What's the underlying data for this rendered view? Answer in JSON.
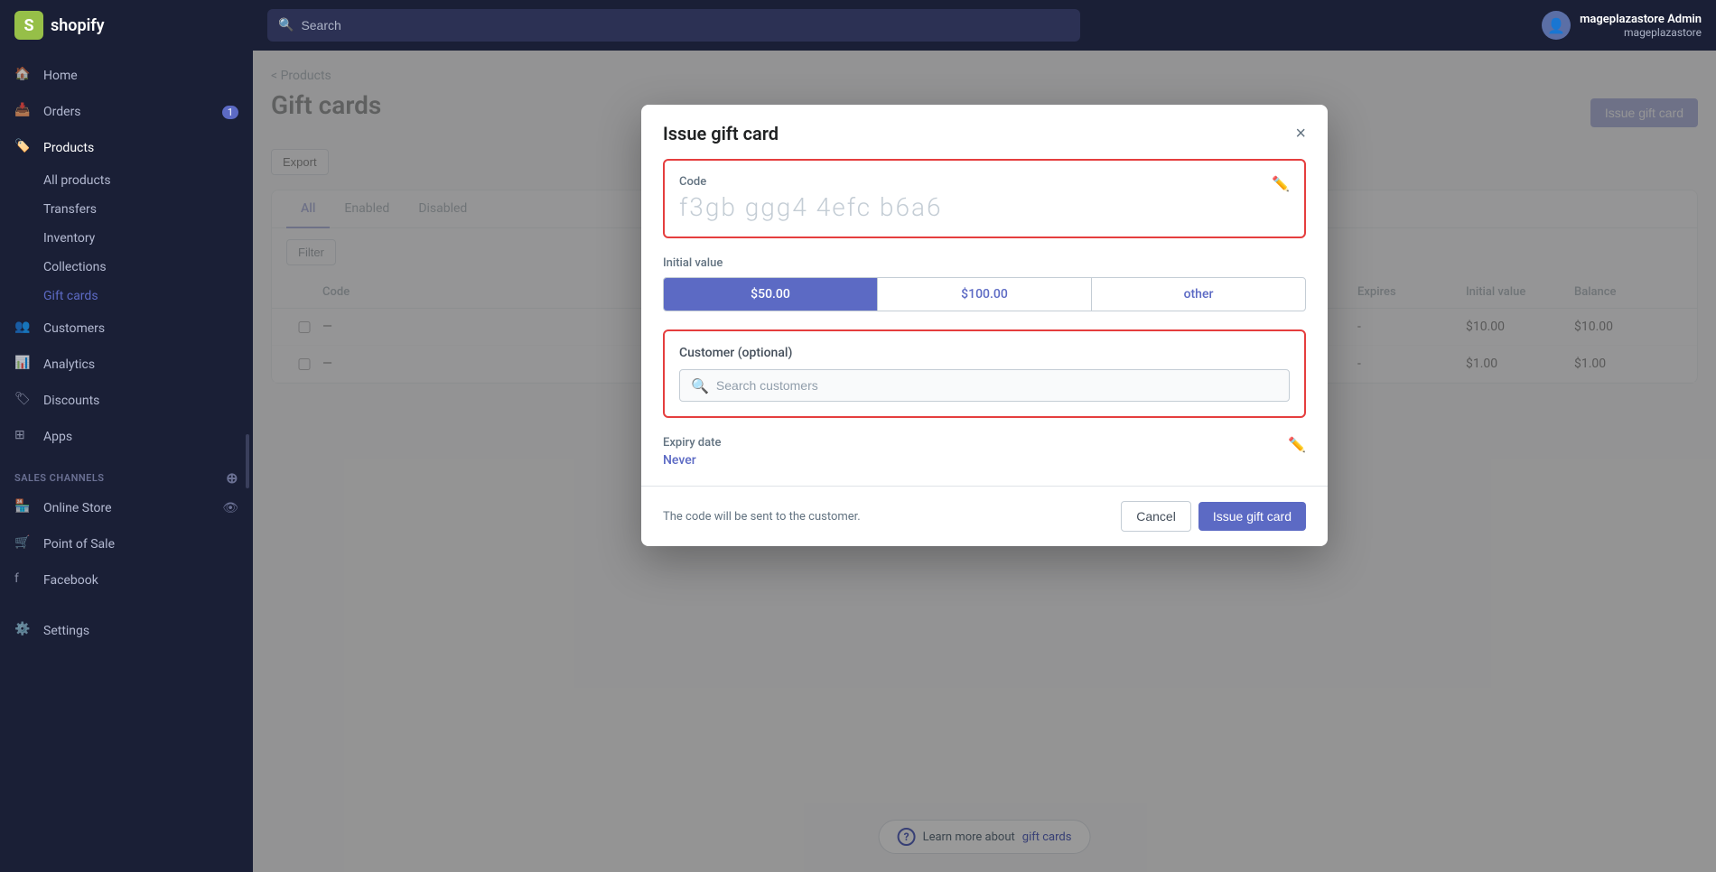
{
  "topNav": {
    "logoText": "shopify",
    "searchPlaceholder": "Search",
    "userName": "mageplazastore Admin",
    "userStore": "mageplazastore"
  },
  "sidebar": {
    "navItems": [
      {
        "id": "home",
        "label": "Home",
        "icon": "home"
      },
      {
        "id": "orders",
        "label": "Orders",
        "icon": "orders",
        "badge": "1"
      },
      {
        "id": "products",
        "label": "Products",
        "icon": "products",
        "active": true
      },
      {
        "id": "customers",
        "label": "Customers",
        "icon": "customers"
      },
      {
        "id": "analytics",
        "label": "Analytics",
        "icon": "analytics"
      },
      {
        "id": "discounts",
        "label": "Discounts",
        "icon": "discounts"
      },
      {
        "id": "apps",
        "label": "Apps",
        "icon": "apps"
      }
    ],
    "productSubItems": [
      {
        "id": "all-products",
        "label": "All products"
      },
      {
        "id": "transfers",
        "label": "Transfers"
      },
      {
        "id": "inventory",
        "label": "Inventory"
      },
      {
        "id": "collections",
        "label": "Collections"
      },
      {
        "id": "gift-cards",
        "label": "Gift cards",
        "highlight": true
      }
    ],
    "salesChannels": {
      "label": "SALES CHANNELS",
      "items": [
        {
          "id": "online-store",
          "label": "Online Store",
          "hasEye": true
        },
        {
          "id": "point-of-sale",
          "label": "Point of Sale"
        },
        {
          "id": "facebook",
          "label": "Facebook"
        }
      ]
    },
    "settingsLabel": "Settings"
  },
  "page": {
    "breadcrumb": "< Products",
    "title": "Gift cards",
    "exportButton": "Export",
    "issueGiftCardButton": "Issue gift card",
    "tabs": [
      {
        "label": "All",
        "active": true
      },
      {
        "label": "Enabled"
      },
      {
        "label": "Disabled"
      }
    ],
    "filterButton": "Filter",
    "tableHeaders": [
      "",
      "Code",
      "Expires",
      "Initial value",
      "Balance"
    ],
    "tableRows": [
      {
        "code": "—",
        "expires": "-",
        "initialValue": "$10.00",
        "balance": "$10.00"
      },
      {
        "code": "—",
        "expires": "-",
        "initialValue": "$1.00",
        "balance": "$1.00"
      }
    ]
  },
  "modal": {
    "title": "Issue gift card",
    "closeLabel": "×",
    "code": {
      "label": "Code",
      "value": "f3gb ggg4 4efc b6a6"
    },
    "initialValue": {
      "label": "Initial value",
      "options": [
        {
          "label": "$50.00",
          "selected": true
        },
        {
          "label": "$100.00",
          "selected": false
        },
        {
          "label": "other",
          "selected": false
        }
      ]
    },
    "customer": {
      "label": "Customer (optional)",
      "searchPlaceholder": "Search customers"
    },
    "expiryDate": {
      "label": "Expiry date",
      "value": "Never"
    },
    "footerNote": "The code will be sent to the customer.",
    "cancelButton": "Cancel",
    "issueButton": "Issue gift card"
  },
  "learnMore": {
    "text": "Learn more about",
    "linkText": "gift cards",
    "linkHref": "#"
  }
}
